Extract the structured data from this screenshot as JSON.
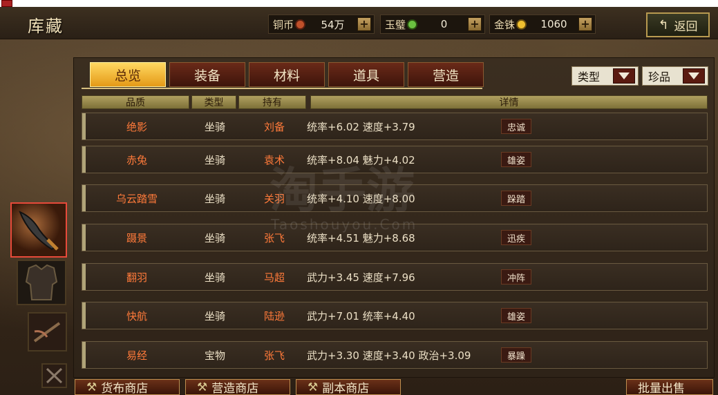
{
  "header": {
    "title": "库藏",
    "back_label": "返回",
    "back_arrow": "↰"
  },
  "resources": [
    {
      "label": "铜币",
      "value": "54万",
      "coin_color": "#c0502a"
    },
    {
      "label": "玉璧",
      "value": "0",
      "coin_color": "#6ac040"
    },
    {
      "label": "金铢",
      "value": "1060",
      "coin_color": "#f0c030"
    }
  ],
  "plus": "+",
  "tabs": [
    "总览",
    "装备",
    "材料",
    "道具",
    "营造"
  ],
  "filters": [
    {
      "label": "类型"
    },
    {
      "label": "珍品"
    }
  ],
  "columns": {
    "quality": "品质",
    "type": "类型",
    "holder": "持有",
    "detail": "详情"
  },
  "rows": [
    {
      "name": "绝影",
      "type": "坐骑",
      "holder": "刘备",
      "detail": "统率+6.02  速度+3.79",
      "trait": "忠诚"
    },
    {
      "name": "赤兔",
      "type": "坐骑",
      "holder": "袁术",
      "detail": "统率+8.04  魅力+4.02",
      "trait": "雄姿"
    },
    {
      "name": "乌云踏雪",
      "type": "坐骑",
      "holder": "关羽",
      "detail": "统率+4.10  速度+8.00",
      "trait": "跺踏"
    },
    {
      "name": "蹑景",
      "type": "坐骑",
      "holder": "张飞",
      "detail": "统率+4.51  魅力+8.68",
      "trait": "迅疾"
    },
    {
      "name": "翻羽",
      "type": "坐骑",
      "holder": "马超",
      "detail": "武力+3.45  速度+7.96",
      "trait": "冲阵"
    },
    {
      "name": "快航",
      "type": "坐骑",
      "holder": "陆逊",
      "detail": "武力+7.01  统率+4.40",
      "trait": "雄姿"
    },
    {
      "name": "易经",
      "type": "宝物",
      "holder": "张飞",
      "detail": "武力+3.30  速度+3.40  政治+3.09",
      "trait": "暴躁"
    }
  ],
  "bottom_buttons": [
    "货布商店",
    "营造商店",
    "副本商店",
    "批量出售"
  ],
  "watermark": {
    "main": "淘手游",
    "sub": "Taoshouyou.Com"
  }
}
